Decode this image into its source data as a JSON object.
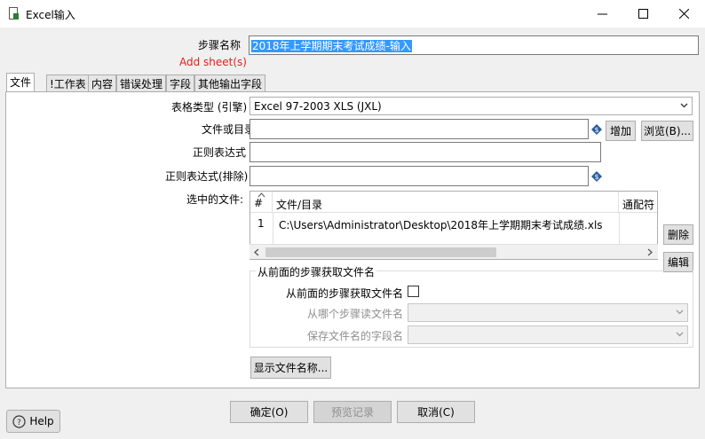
{
  "window": {
    "title": "Excel输入",
    "minimize_icon": "minimize-icon",
    "maximize_icon": "maximize-icon",
    "close_icon": "close-icon"
  },
  "step": {
    "label": "步骤名称",
    "value": "2018年上学期期末考试成绩-输入",
    "add_sheet_warning": "Add sheet(s)"
  },
  "tabs": [
    {
      "label": "文件",
      "active": true
    },
    {
      "label": "!工作表",
      "active": false
    },
    {
      "label": "内容",
      "active": false
    },
    {
      "label": "错误处理",
      "active": false
    },
    {
      "label": "字段",
      "active": false
    },
    {
      "label": "其他输出字段",
      "active": false
    }
  ],
  "file_tab": {
    "spreadsheet_type_label": "表格类型 (引擎)",
    "spreadsheet_type_value": "Excel 97-2003 XLS (JXL)",
    "file_or_dir_label": "文件或目录",
    "file_or_dir_value": "",
    "add_button": "增加",
    "browse_button": "浏览(B)...",
    "regex_label": "正则表达式",
    "regex_value": "",
    "regex_exclude_label": "正则表达式(排除)",
    "regex_exclude_value": "",
    "selected_files_label": "选中的文件:",
    "table": {
      "columns": [
        "#",
        "文件/目录",
        "通配符"
      ],
      "rows": [
        {
          "num": "1",
          "path": "C:\\Users\\Administrator\\Desktop\\2018年上学期期末考试成绩.xls",
          "wildcard": ""
        }
      ]
    },
    "delete_button": "删除",
    "edit_button": "编辑",
    "from_previous": {
      "group_title": "从前面的步骤获取文件名",
      "checkbox_label": "从前面的步骤获取文件名",
      "checkbox_checked": false,
      "step_label": "从哪个步骤读文件名",
      "step_value": "",
      "field_label": "保存文件名的字段名",
      "field_value": ""
    },
    "show_filenames_button": "显示文件名称..."
  },
  "footer": {
    "ok_button": "确定(O)",
    "preview_button": "预览记录",
    "cancel_button": "取消(C)",
    "help_button": "Help"
  },
  "colors": {
    "selection": "#3399ff",
    "warning": "#e0211b"
  }
}
